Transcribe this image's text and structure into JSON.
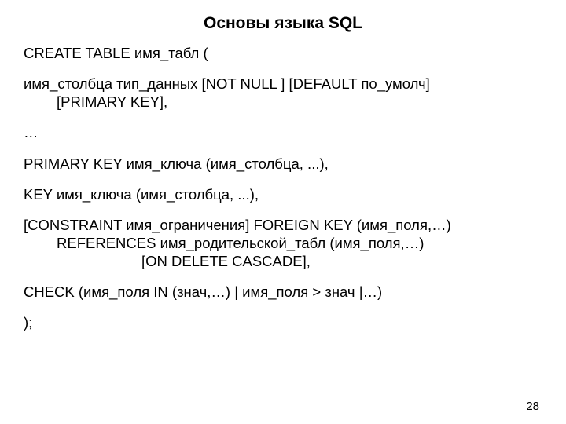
{
  "title": "Основы языка SQL",
  "lines": {
    "l1": "CREATE TABLE имя_табл (",
    "l2a": "имя_столбца тип_данных [NOT NULL ] [DEFAULT по_умолч]",
    "l2b": "[PRIMARY KEY],",
    "l3": "…",
    "l4": "PRIMARY KEY имя_ключа (имя_столбца, ...),",
    "l5": "KEY имя_ключа (имя_столбца, ...),",
    "l6a": "[CONSTRAINT имя_ограничения] FOREIGN KEY (имя_поля,…)",
    "l6b": "REFERENCES имя_родительской_табл (имя_поля,…)",
    "l6c": "[ON DELETE CASCADE],",
    "l7": "CHECK (имя_поля IN (знач,…) | имя_поля > знач |…)",
    "l8": ");"
  },
  "page_number": "28"
}
